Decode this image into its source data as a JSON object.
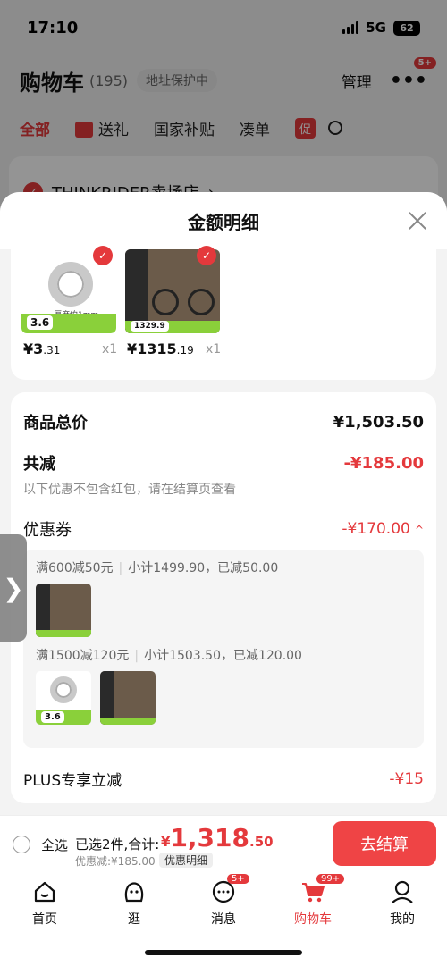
{
  "status_bar": {
    "time": "17:10",
    "network": "5G",
    "battery": "62"
  },
  "background": {
    "title": "购物车",
    "count": "(195)",
    "address_protect": "地址保护中",
    "manage": "管理",
    "more_badge": "5+",
    "tabs": [
      "全部",
      "送礼",
      "国家补贴",
      "凑单"
    ],
    "promo_tag": "促",
    "store_name": "THINKRIDER卖场店"
  },
  "sheet": {
    "title": "金额明细",
    "products": [
      {
        "price_int": "¥3",
        "price_dec": ".31",
        "qty": "x1",
        "thumb_label": "厚度约1mm",
        "thumb_tag": "3.6"
      },
      {
        "price_int": "¥1315",
        "price_dec": ".19",
        "qty": "x1",
        "thumb_tag": "1329.9"
      }
    ],
    "total_label": "商品总价",
    "total_value": "¥1,503.50",
    "discount_label": "共减",
    "discount_value": "-¥185.00",
    "discount_note": "以下优惠不包含红包，请在结算页查看",
    "coupon_label": "优惠券",
    "coupon_value": "-¥170.00",
    "coupons": [
      {
        "rule": "满600减50元",
        "detail": "小计1499.90，已减50.00"
      },
      {
        "rule": "满1500减120元",
        "detail": "小计1503.50，已减120.00"
      }
    ],
    "plus_label": "PLUS专享立减",
    "plus_value": "-¥15"
  },
  "checkout": {
    "select_all": "全选",
    "selected": "已选2件,合计:",
    "total_cur": "¥",
    "total_int": "1,318",
    "total_dec": ".50",
    "discount": "优惠减:¥185.00",
    "detail_link": "优惠明细",
    "button": "去结算"
  },
  "tabbar": [
    {
      "label": "首页",
      "icon": "home-icon"
    },
    {
      "label": "逛",
      "icon": "browse-icon"
    },
    {
      "label": "消息",
      "icon": "message-icon",
      "badge": "5+"
    },
    {
      "label": "购物车",
      "icon": "cart-icon",
      "badge": "99+",
      "active": true
    },
    {
      "label": "我的",
      "icon": "profile-icon"
    }
  ],
  "colors": {
    "accent": "#e4393c",
    "button": "#ef4445"
  }
}
